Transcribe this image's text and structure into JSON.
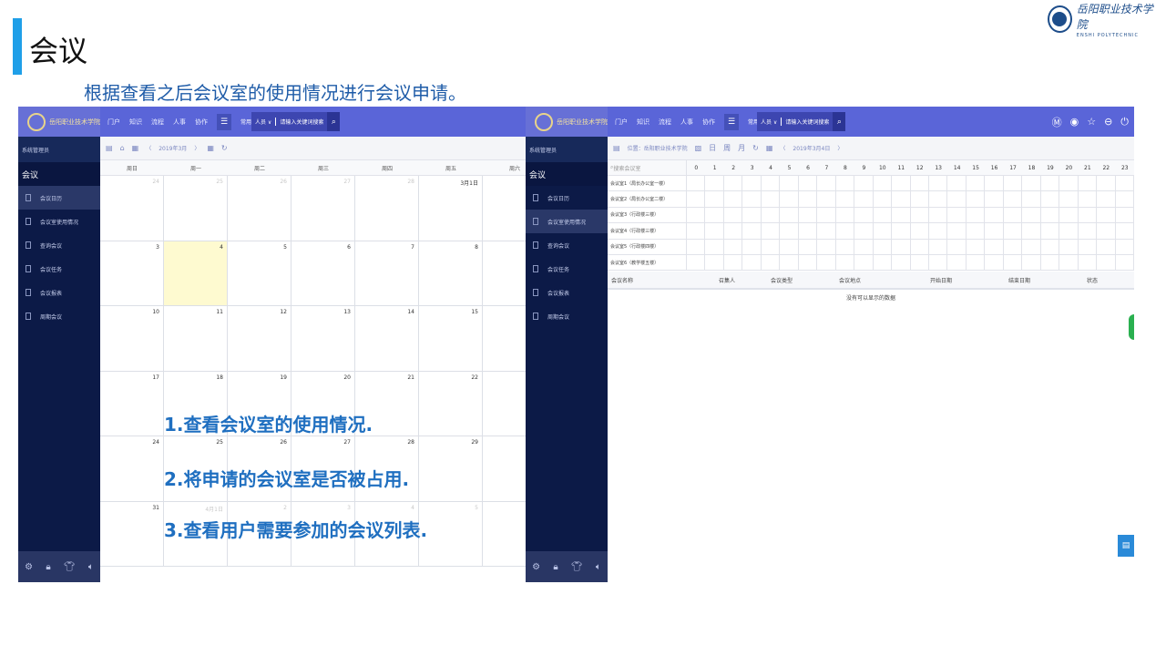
{
  "slide": {
    "title": "会议",
    "subtitle": "根据查看之后会议室的使用情况进行会议申请。",
    "logo_cn": "岳阳职业技术学院",
    "logo_en": "ENSHI POLYTECHNIC",
    "accent_color": "#1f9fe8"
  },
  "app": {
    "logo_text": "岳阳职业技术学院",
    "nav": [
      "门户",
      "知识",
      "流程",
      "人事",
      "协作"
    ],
    "common_label": "常用",
    "search_type": "人员",
    "search_placeholder": "请输入关键词搜索",
    "brand_color": "#5a65d8",
    "sidebar_bg": "#0c1a47",
    "admin_label": "系统管理员",
    "module_title": "会议",
    "sidebar_items": [
      "会议日历",
      "会议室使用情况",
      "查询会议",
      "会议任务",
      "会议报表",
      "周期会议"
    ]
  },
  "calendar": {
    "month_label": "2019年3月",
    "weekdays": [
      "周日",
      "周一",
      "周二",
      "周三",
      "周四",
      "周五",
      "周六"
    ],
    "weeks": [
      [
        "24",
        "25",
        "26",
        "27",
        "28",
        "3月1日",
        ""
      ],
      [
        "3",
        "4",
        "5",
        "6",
        "7",
        "8",
        ""
      ],
      [
        "10",
        "11",
        "12",
        "13",
        "14",
        "15",
        ""
      ],
      [
        "17",
        "18",
        "19",
        "20",
        "21",
        "22",
        ""
      ],
      [
        "24",
        "25",
        "26",
        "27",
        "28",
        "29",
        ""
      ],
      [
        "31",
        "4月1日",
        "2",
        "3",
        "4",
        "5",
        ""
      ]
    ]
  },
  "overlay_notes": [
    "1.查看会议室的使用情况.",
    "2.将申请的会议室是否被占用.",
    "3.查看用户需要参加的会议列表."
  ],
  "rooms": {
    "location": "位置：岳阳职业技术学院",
    "date_label": "2019年3月4日",
    "search_placeholder": "搜索会议室",
    "hours": [
      "0",
      "1",
      "2",
      "3",
      "4",
      "5",
      "6",
      "7",
      "8",
      "9",
      "10",
      "11",
      "12",
      "13",
      "14",
      "15",
      "16",
      "17",
      "18",
      "19",
      "20",
      "21",
      "22",
      "23"
    ],
    "list": [
      "会议室1（局长办公室一楼）",
      "会议室2（局长办公室二楼）",
      "会议室3（行政楼三楼）",
      "会议室4（行政楼三楼）",
      "会议室5（行政楼四楼）",
      "会议室6（教学楼五楼）"
    ],
    "table_columns": [
      "会议名称",
      "召集人",
      "会议类型",
      "会议地点",
      "开始日期",
      "结束日期",
      "状态"
    ],
    "empty_text": "没有可以显示的数据"
  }
}
